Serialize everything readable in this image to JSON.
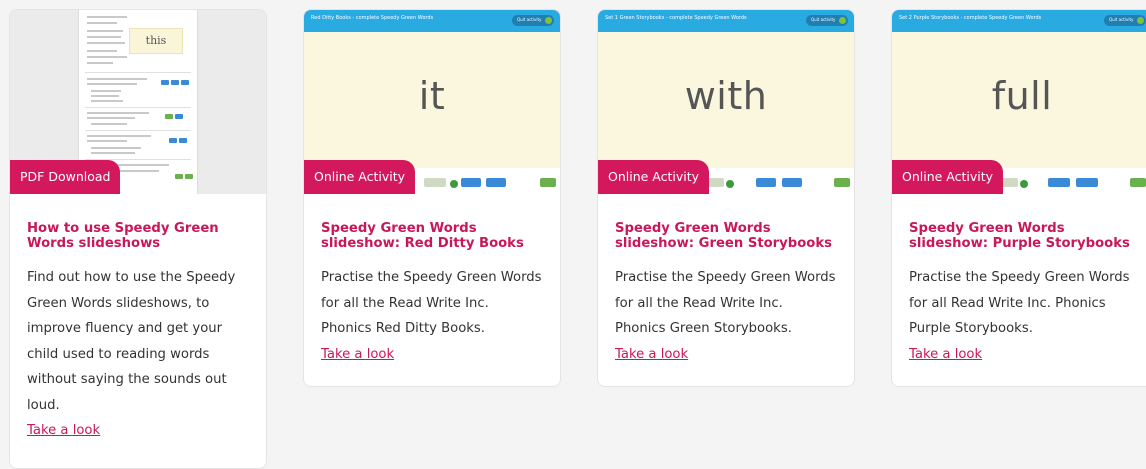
{
  "cards": [
    {
      "badge": "PDF Download",
      "title": "How to use Speedy Green Words slideshows",
      "description": "Find out how to use the Speedy Green Words slideshows, to improve fluency and get your child used to reading words without saying the sounds out loud.",
      "link": "Take a look",
      "thumb_word": "this"
    },
    {
      "badge": "Online Activity",
      "title": "Speedy Green Words slideshow: Red Ditty Books",
      "description": "Practise the Speedy Green Words for all the Read Write Inc. Phonics Red Ditty Books.",
      "link": "Take a look",
      "thumb_header": "Red Ditty Books - complete Speedy Green Words",
      "thumb_exit": "Quit activity",
      "thumb_word": "it"
    },
    {
      "badge": "Online Activity",
      "title": "Speedy Green Words slideshow: Green Storybooks",
      "description": "Practise the Speedy Green Words for all the Read Write Inc. Phonics Green Storybooks.",
      "link": "Take a look",
      "thumb_header": "Set 1 Green Storybooks - complete Speedy Green Words",
      "thumb_exit": "Quit activity",
      "thumb_word": "with"
    },
    {
      "badge": "Online Activity",
      "title": "Speedy Green Words slideshow: Purple Storybooks",
      "description": "Practise the Speedy Green Words for all Read Write Inc. Phonics Purple Storybooks.",
      "link": "Take a look",
      "thumb_header": "Set 2 Purple Storybooks - complete Speedy Green Words",
      "thumb_exit": "Quit activity",
      "thumb_word": "full"
    }
  ],
  "colors": {
    "accent": "#d4185d",
    "title": "#c8175a",
    "slide_bar": "#29aae1",
    "slide_bg": "#fbf6de"
  }
}
